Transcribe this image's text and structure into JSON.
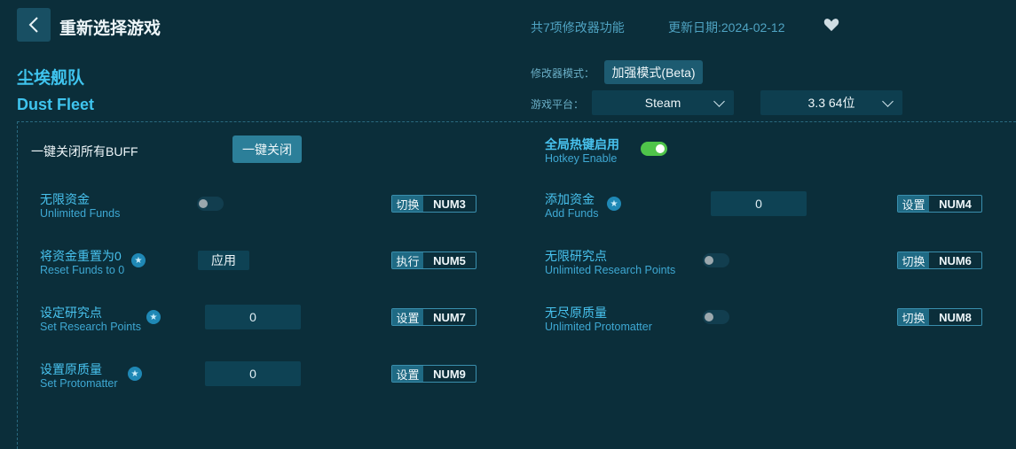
{
  "header": {
    "title": "重新选择游戏",
    "feature_count": "共7项修改器功能",
    "update_date": "更新日期:2024-02-12"
  },
  "game": {
    "name_cn": "尘埃舰队",
    "name_en": "Dust Fleet"
  },
  "settings": {
    "mode_label": "修改器模式：",
    "mode_value": "加强模式(Beta)",
    "platform_label": "游戏平台：",
    "platform_value": "Steam",
    "version_value": "3.3 64位"
  },
  "global": {
    "disable_all_label": "一键关闭所有BUFF",
    "disable_all_button": "一键关闭",
    "hotkey_cn": "全局热键启用",
    "hotkey_en": "Hotkey Enable",
    "hotkey_enabled": true
  },
  "cheats": [
    {
      "cn": "无限资金",
      "en": "Unlimited Funds",
      "action": "切换",
      "key": "NUM3"
    },
    {
      "cn": "添加资金",
      "en": "Add Funds",
      "value": "0",
      "action": "设置",
      "key": "NUM4"
    },
    {
      "cn": "将资金重置为0",
      "en": "Reset Funds to 0",
      "apply": "应用",
      "action": "执行",
      "key": "NUM5"
    },
    {
      "cn": "无限研究点",
      "en": "Unlimited Research Points",
      "action": "切换",
      "key": "NUM6"
    },
    {
      "cn": "设定研究点",
      "en": "Set Research Points",
      "value": "0",
      "action": "设置",
      "key": "NUM7"
    },
    {
      "cn": "无尽原质量",
      "en": "Unlimited Protomatter",
      "action": "切换",
      "key": "NUM8"
    },
    {
      "cn": "设置原质量",
      "en": "Set Protomatter",
      "value": "0",
      "action": "设置",
      "key": "NUM9"
    }
  ],
  "colors": {
    "background": "#0b2e3a",
    "accent": "#3fc4ee",
    "toggle_on": "#4fc44a"
  }
}
